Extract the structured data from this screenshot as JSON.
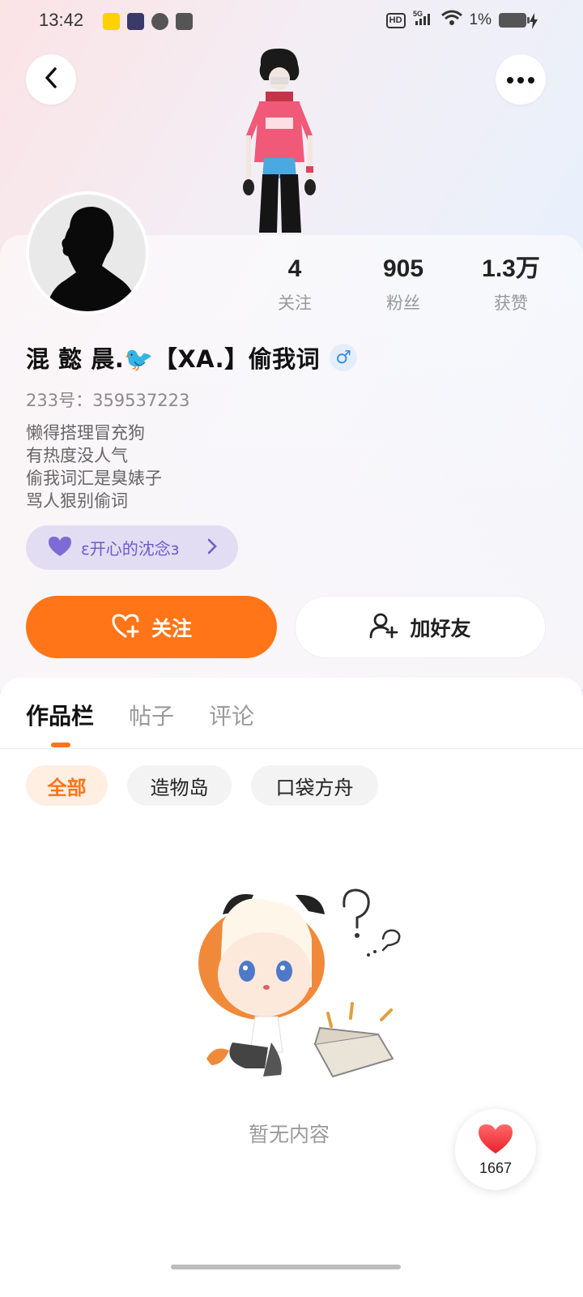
{
  "status_bar": {
    "time": "13:42",
    "network": "5G",
    "hd": "HD",
    "battery": "1%",
    "app_icons": [
      "meituan-icon",
      "video-app-icon",
      "message-icon",
      "wallet-icon"
    ],
    "app_colors": [
      "#ffd100",
      "#3a3a6a",
      "#555555",
      "#555555"
    ]
  },
  "header": {
    "back_icon": "chevron-left-icon",
    "more_icon": "more-dots-icon"
  },
  "profile": {
    "stats": [
      {
        "value": "4",
        "label": "关注"
      },
      {
        "value": "905",
        "label": "粉丝"
      },
      {
        "value": "1.3万",
        "label": "获赞"
      }
    ],
    "nickname": "混 懿 晨.🐦【XA.】偷我词",
    "gender": "♂",
    "uid": "233号：359537223",
    "bio": [
      "懒得搭理冒充狗",
      "有热度没人气",
      "偷我词汇是臭婊子",
      "骂人狠别偷词"
    ],
    "medal": "ε开心的沈念з",
    "follow_label": "关注",
    "add_friend_label": "加好友"
  },
  "tabs": [
    {
      "label": "作品栏",
      "active": true
    },
    {
      "label": "帖子",
      "active": false
    },
    {
      "label": "评论",
      "active": false
    }
  ],
  "filters": [
    {
      "label": "全部",
      "active": true
    },
    {
      "label": "造物岛",
      "active": false
    },
    {
      "label": "口袋方舟",
      "active": false
    }
  ],
  "empty_state": {
    "text": "暂无内容"
  },
  "like_fab": {
    "count": "1667"
  },
  "colors": {
    "accent": "#ff7518",
    "medal_bg": "#e3ddf4",
    "medal_text": "#6a5cc8"
  }
}
